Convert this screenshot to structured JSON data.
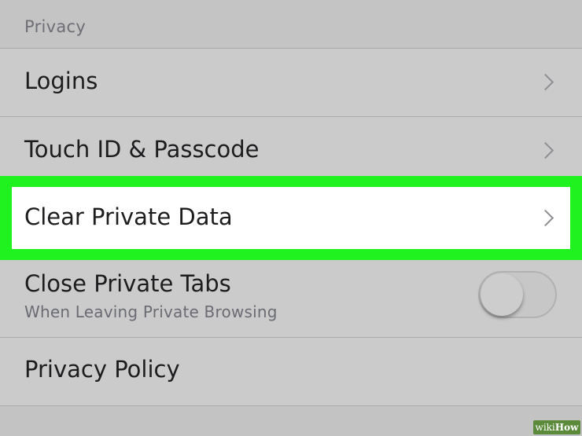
{
  "section": {
    "title": "Privacy"
  },
  "rows": {
    "logins": {
      "label": "Logins"
    },
    "touch_id": {
      "label": "Touch ID & Passcode"
    },
    "clear_private_data": {
      "label": "Clear Private Data"
    },
    "close_private_tabs": {
      "label": "Close Private Tabs",
      "sublabel": "When Leaving Private Browsing",
      "toggle_state": "off"
    },
    "privacy_policy": {
      "label": "Privacy Policy"
    }
  },
  "watermark": {
    "wiki": "wiki",
    "how": "How"
  },
  "colors": {
    "highlight": "#1ff21e",
    "background": "#c9c9c9",
    "text": "#1d1d1f",
    "secondary_text": "#6e6f76"
  },
  "icons": {
    "chevron": "chevron-right-icon"
  }
}
